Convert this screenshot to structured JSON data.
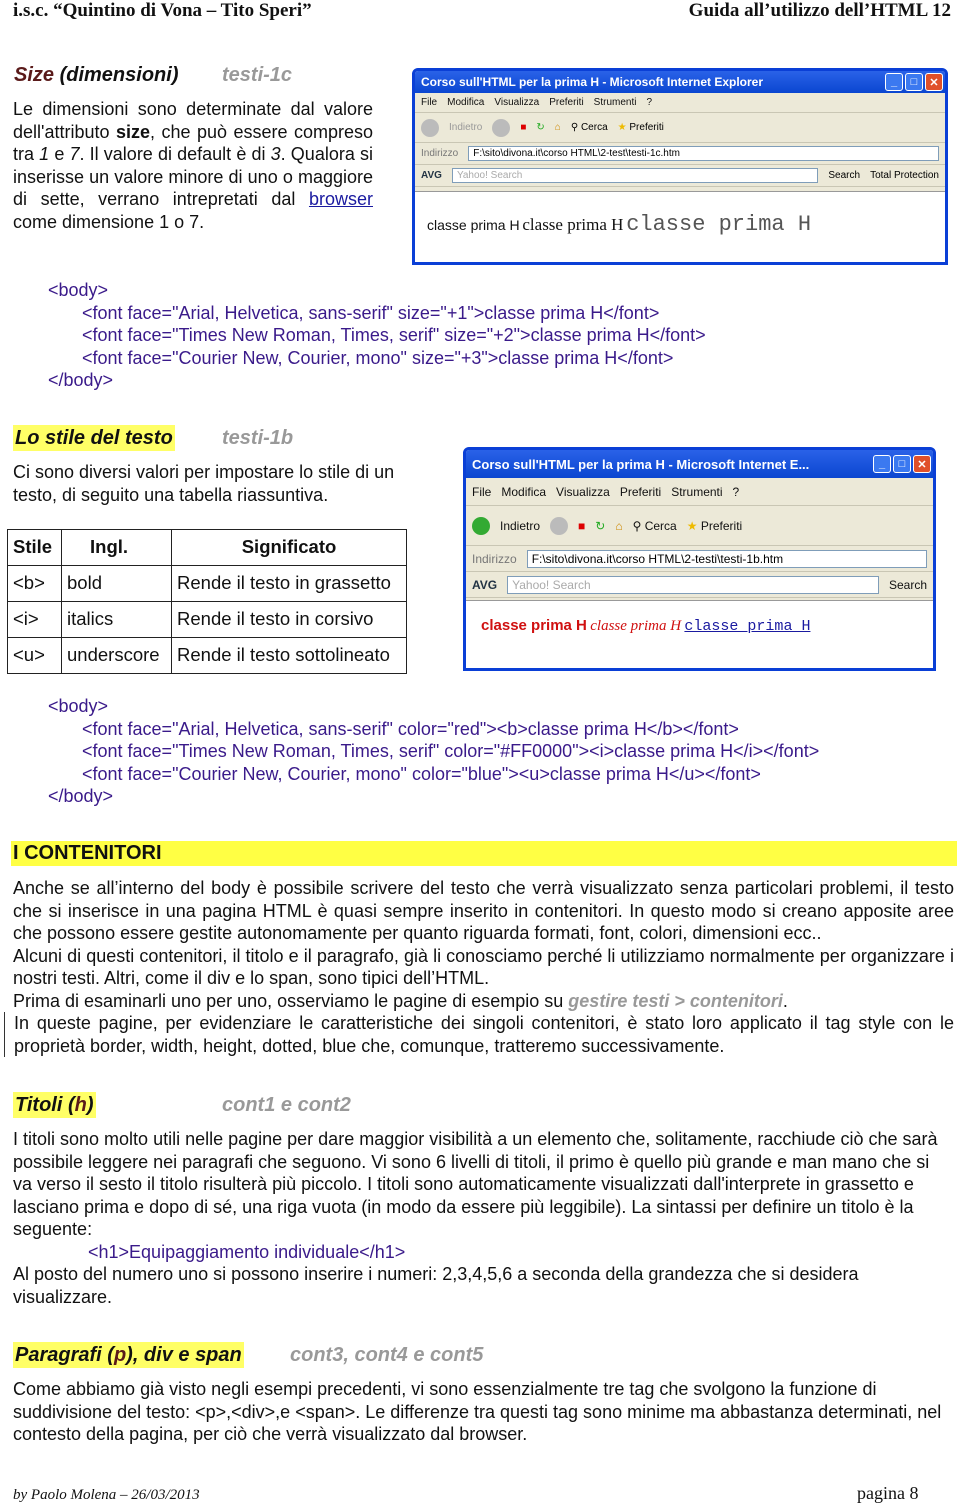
{
  "header": {
    "left": "i.s.c. “Quintino di Vona – Tito Speri”",
    "right": "Guida all’utilizzo dell’HTML 12"
  },
  "s1": {
    "title_a": "Size",
    "title_b": " (dimensioni)",
    "ref": "testi-1c",
    "p_1": "Le dimensioni sono determinate dal valore dell'attributo ",
    "p_bold": "size",
    "p_2": ", che può essere compreso tra ",
    "p_i1": "1",
    "p_3": " e ",
    "p_i2": "7",
    "p_4": ". Il valore di default è di ",
    "p_i3": "3",
    "p_5": ". Qualora si inserisse un valore minore di uno o maggiore di sette, verrano intrepretati dal ",
    "p_link": "browser",
    "p_6": " come dimensione 1 o 7.",
    "code": [
      "<body>",
      "<font face=\"Arial, Helvetica, sans-serif\" size=\"+1\">classe prima H</font>",
      "<font face=\"Times New Roman, Times, serif\" size=\"+2\">classe prima H</font>",
      "<font face=\"Courier New, Courier, mono\" size=\"+3\">classe prima H</font>",
      "</body>"
    ]
  },
  "ie1": {
    "title": "Corso sull'HTML per la prima H - Microsoft Internet Explorer",
    "menu": [
      "File",
      "Modifica",
      "Visualizza",
      "Preferiti",
      "Strumenti",
      "?"
    ],
    "back": "Indietro",
    "search": "Cerca",
    "fav": "Preferiti",
    "addr_label": "Indirizzo",
    "addr": "F:\\sito\\divona.it\\corso HTML\\2-test\\testi-1c.htm",
    "avg": "AVG",
    "yahoo": "Yahoo! Search",
    "search_btn": "Search",
    "protection": "Total Protection",
    "content": [
      "classe prima H",
      "classe prima H",
      "classe prima H"
    ]
  },
  "s2": {
    "title": "Lo stile del testo",
    "ref": "testi-1b",
    "p": "Ci sono diversi valori per impostare lo stile di un testo, di seguito una tabella riassuntiva.",
    "table": {
      "headers": [
        "Stile",
        "Ingl.",
        "Significato"
      ],
      "rows": [
        [
          "<b>",
          "bold",
          "Rende il testo in grassetto"
        ],
        [
          "<i>",
          "italics",
          "Rende il testo in corsivo"
        ],
        [
          "<u>",
          "underscore",
          "Rende il testo sottolineato"
        ]
      ]
    },
    "code": [
      "<body>",
      "<font face=\"Arial, Helvetica, sans-serif\" color=\"red\"><b>classe prima H</b></font>",
      "<font face=\"Times New Roman, Times, serif\" color=\"#FF0000\"><i>classe prima H</i></font>",
      "<font face=\"Courier New, Courier, mono\" color=\"blue\"><u>classe prima H</u></font>",
      "</body>"
    ]
  },
  "ie2": {
    "title": "Corso sull'HTML per la prima H - Microsoft Internet E...",
    "menu": [
      "File",
      "Modifica",
      "Visualizza",
      "Preferiti",
      "Strumenti",
      "?"
    ],
    "back": "Indietro",
    "search": "Cerca",
    "fav": "Preferiti",
    "addr_label": "Indirizzo",
    "addr": "F:\\sito\\divona.it\\corso HTML\\2-testi\\testi-1b.htm",
    "avg": "AVG",
    "yahoo": "Yahoo! Search",
    "search_btn": "Search",
    "content": [
      "classe prima H",
      "classe prima H",
      "classe prima H"
    ]
  },
  "s3": {
    "title": "I CONTENITORI",
    "p1": "Anche se all’interno del body è possibile scrivere del testo che verrà visualizzato senza particolari problemi, il testo che si inserisce in una pagina HTML è quasi sempre inserito in contenitori. In questo modo si creano apposite aree che possono essere gestite autonomamente per quanto riguarda formati, font, colori, dimensioni ecc..",
    "p2": "Alcuni di questi contenitori, il titolo e il paragrafo, già li conosciamo perché li utilizziamo normalmente per organizzare i nostri testi. Altri, come il div e lo span, sono tipici dell’HTML.",
    "p3_a": "Prima di esaminarli uno per uno, osserviamo le pagine di esempio su ",
    "p3_ref": "gestire testi > contenitori",
    "p3_b": ".",
    "p4": "In queste pagine, per evidenziare le caratteristiche dei singoli contenitori, è stato loro applicato il tag style con le proprietà border,  width, height, dotted, blue che, comunque, tratteremo successivamente."
  },
  "s4": {
    "title_a": "Titoli (",
    "title_b": "h",
    "title_c": ")",
    "ref": "cont1 e cont2",
    "p1": "I titoli sono molto utili nelle pagine per dare maggior visibilità a un elemento che, solitamente, racchiude ciò che sarà possibile leggere nei paragrafi che seguono. Vi sono 6 livelli di titoli, il primo è quello più grande e man mano che si va verso il sesto il titolo risulterà più piccolo. I titoli sono automaticamente visualizzati dall'interprete in grassetto e lasciano prima e dopo di sé, una riga vuota (in modo da essere più leggibile). La sintassi per definire un titolo è la seguente:",
    "code": "<h1>Equipaggiamento individuale</h1>",
    "p2": "Al posto del numero uno si possono inserire i numeri: 2,3,4,5,6 a seconda della grandezza che si desidera visualizzare."
  },
  "s5": {
    "title_a": "Paragrafi (",
    "title_b": "p",
    "title_c": "), div e span",
    "ref": "cont3, cont4 e cont5",
    "p": "Come abbiamo già visto negli esempi precedenti, vi sono essenzialmente tre tag che svolgono la funzione di suddivisione del testo: <p>,<div>,e <span>. Le differenze tra questi tag sono minime ma abbastanza determinati, nel contesto della pagina, per ciò che verrà visualizzato dal browser."
  },
  "footer": {
    "left": "by Paolo Molena – 26/03/2013",
    "right": "pagina 8"
  },
  "colors": {
    "highlight": "#ffff44",
    "code": "#3a1a8a",
    "ref": "#999999",
    "ie_blue": "#0a3fd6"
  }
}
